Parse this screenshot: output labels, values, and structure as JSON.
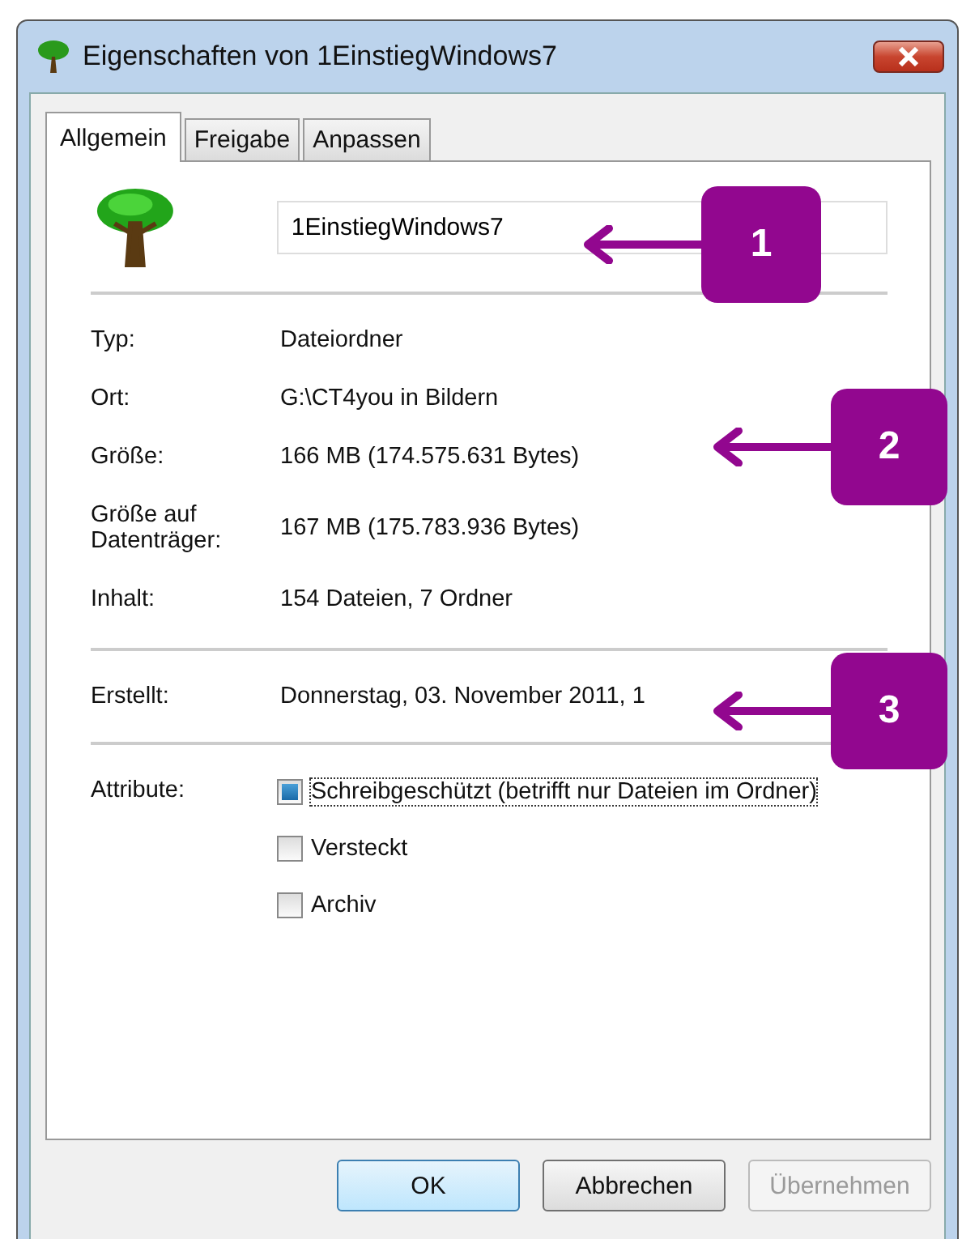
{
  "window": {
    "title": "Eigenschaften von 1EinstiegWindows7"
  },
  "tabs": [
    {
      "label": "Allgemein",
      "selected": true
    },
    {
      "label": "Freigabe",
      "selected": false
    },
    {
      "label": "Anpassen",
      "selected": false
    }
  ],
  "name_field": {
    "value": "1EinstiegWindows7"
  },
  "properties": [
    {
      "label": "Typ:",
      "value": "Dateiordner"
    },
    {
      "label": "Ort:",
      "value": "G:\\CT4you in Bildern"
    },
    {
      "label": "Größe:",
      "value": "166 MB (174.575.631 Bytes)"
    },
    {
      "label": "Größe auf Datenträger:",
      "value": "167 MB (175.783.936 Bytes)"
    },
    {
      "label": "Inhalt:",
      "value": "154 Dateien, 7 Ordner"
    }
  ],
  "created": {
    "label": "Erstellt:",
    "value": "Donnerstag, 03. November 2011, 1"
  },
  "attributes": {
    "label": "Attribute:",
    "options": [
      {
        "label": "Schreibgeschützt (betrifft nur Dateien im Ordner)",
        "mixed": true,
        "focused": true
      },
      {
        "label": "Versteckt",
        "mixed": false,
        "focused": false
      },
      {
        "label": "Archiv",
        "mixed": false,
        "focused": false
      }
    ]
  },
  "buttons": [
    {
      "label": "OK",
      "kind": "default",
      "disabled": false
    },
    {
      "label": "Abbrechen",
      "kind": "normal",
      "disabled": false
    },
    {
      "label": "Übernehmen",
      "kind": "normal",
      "disabled": true
    }
  ],
  "callouts": [
    {
      "number": "1",
      "color": "#92078f"
    },
    {
      "number": "2",
      "color": "#92078f"
    },
    {
      "number": "3",
      "color": "#92078f"
    }
  ]
}
